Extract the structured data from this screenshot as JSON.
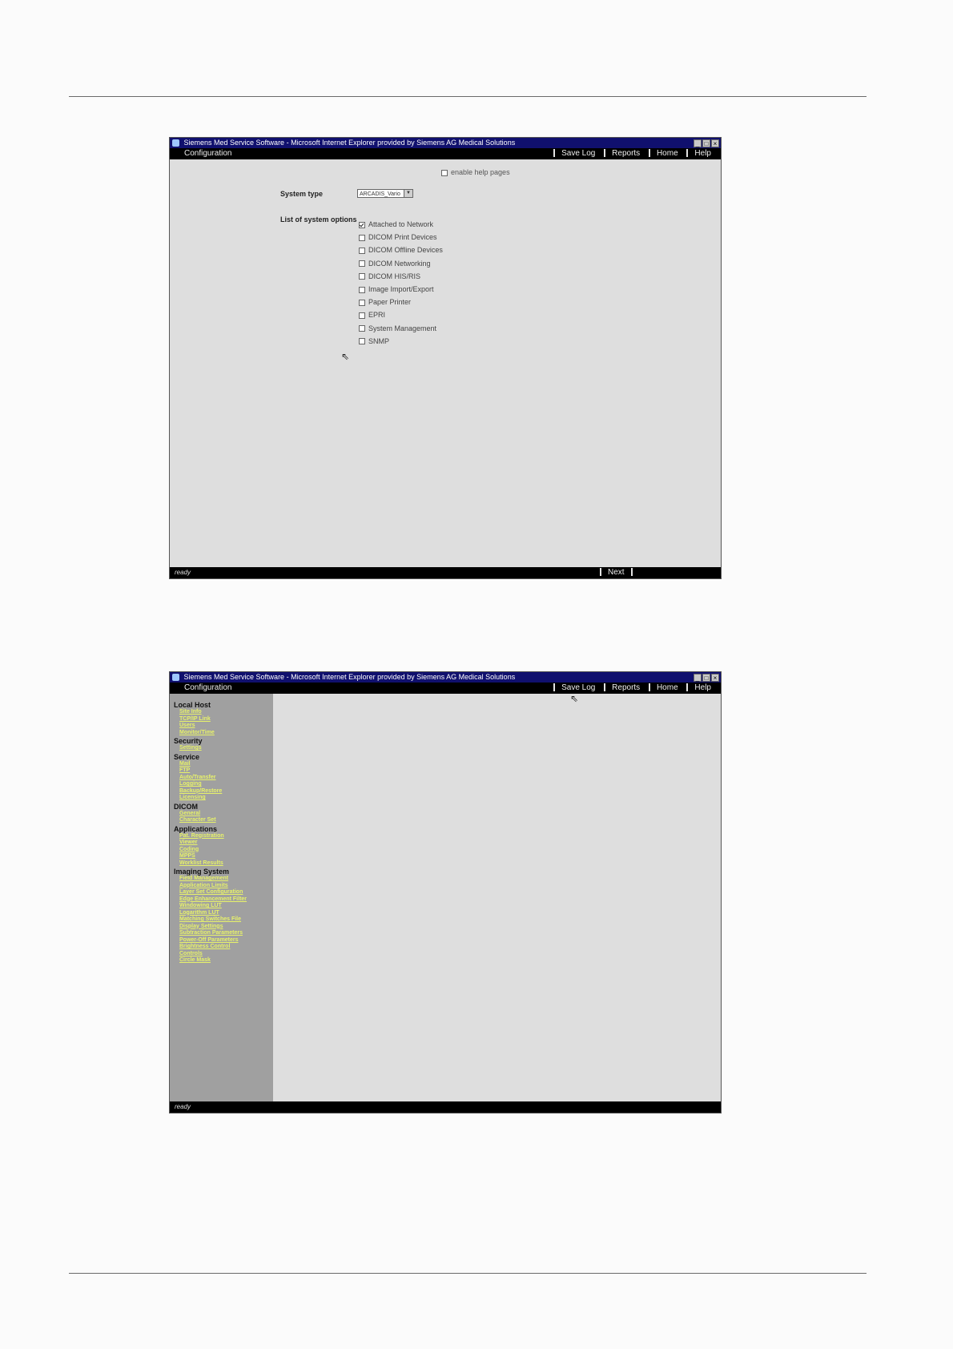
{
  "window1": {
    "title": "Siemens Med Service Software - Microsoft Internet Explorer provided by Siemens AG Medical Solutions",
    "app_name": "Configuration",
    "nav": [
      "Save Log",
      "Reports",
      "Home",
      "Help"
    ],
    "enable_help": "enable help pages",
    "system_type_label": "System type",
    "system_type_value": "ARCADIS_Vario",
    "options_label": "List of system options",
    "options": [
      {
        "label": "Attached to Network",
        "checked": true
      },
      {
        "label": "DICOM Print Devices",
        "checked": false
      },
      {
        "label": "DICOM Offline Devices",
        "checked": false
      },
      {
        "label": "DICOM Networking",
        "checked": false
      },
      {
        "label": "DICOM HIS/RIS",
        "checked": false
      },
      {
        "label": "Image Import/Export",
        "checked": false
      },
      {
        "label": "Paper Printer",
        "checked": false
      },
      {
        "label": "EPRI",
        "checked": false
      },
      {
        "label": "System Management",
        "checked": false
      },
      {
        "label": "SNMP",
        "checked": false
      }
    ],
    "status": "ready",
    "next": "Next"
  },
  "window2": {
    "title": "Siemens Med Service Software - Microsoft Internet Explorer provided by Siemens AG Medical Solutions",
    "app_name": "Configuration",
    "nav": [
      "Save Log",
      "Reports",
      "Home",
      "Help"
    ],
    "status": "ready",
    "sidebar": [
      {
        "section": "Local Host",
        "links": [
          "Site Info",
          "TCP/IP Link",
          "Users",
          "Monitor/Time"
        ]
      },
      {
        "section": "Security",
        "links": [
          "Settings"
        ]
      },
      {
        "section": "Service",
        "links": [
          "Mail",
          "FTP",
          "Auto/Transfer",
          "Logging",
          "Backup/Restore",
          "Licensing"
        ]
      },
      {
        "section": "DICOM",
        "links": [
          "General",
          "Character Set"
        ]
      },
      {
        "section": "Applications",
        "links": [
          "Pat. Registration",
          "Viewer",
          "Coding",
          "MPPS",
          "Worklist Results"
        ]
      },
      {
        "section": "Imaging System",
        "links": [
          "Field Management",
          "Application Limits",
          "Layer Set Configuration",
          "Edge Enhancement Filter",
          "Windowing LUT",
          "Logarithm LUT",
          "Matching Switches File",
          "Display Settings",
          "Subtraction Parameters",
          "Power-Off Parameters",
          "Brightness Control",
          "Controls",
          "Circle Mask"
        ]
      }
    ]
  }
}
